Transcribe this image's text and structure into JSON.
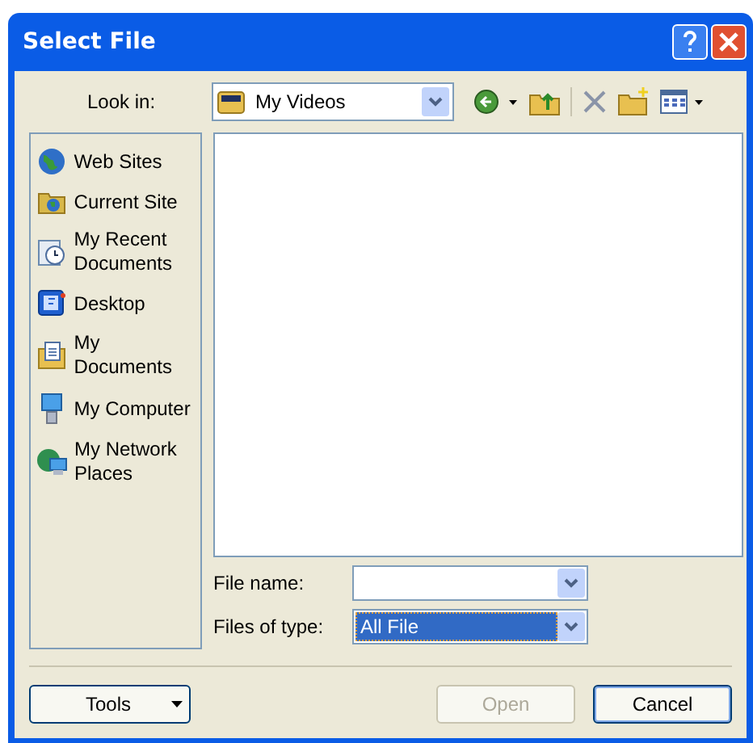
{
  "window": {
    "title": "Select File"
  },
  "look_in": {
    "label": "Look in:",
    "value": "My Videos"
  },
  "sidebar": {
    "items": [
      {
        "label": "Web Sites",
        "selected": false
      },
      {
        "label": "Current Site",
        "selected": false
      },
      {
        "label": "My Recent Documents",
        "selected": false
      },
      {
        "label": "Desktop",
        "selected": false
      },
      {
        "label": "My Documents",
        "selected": false
      },
      {
        "label": "My Computer",
        "selected": false
      },
      {
        "label": "My Network Places",
        "selected": false
      }
    ]
  },
  "file_name": {
    "label": "File name:"
  },
  "file_type": {
    "label": "Files of type:",
    "value": "All File",
    "focused": true
  },
  "buttons": [
    {
      "label": "Tools",
      "kind": "menu",
      "disabled": false,
      "default": false
    },
    {
      "label": "Open",
      "kind": "push",
      "disabled": true,
      "default": false
    },
    {
      "label": "Cancel",
      "kind": "push",
      "disabled": false,
      "default": true
    }
  ]
}
